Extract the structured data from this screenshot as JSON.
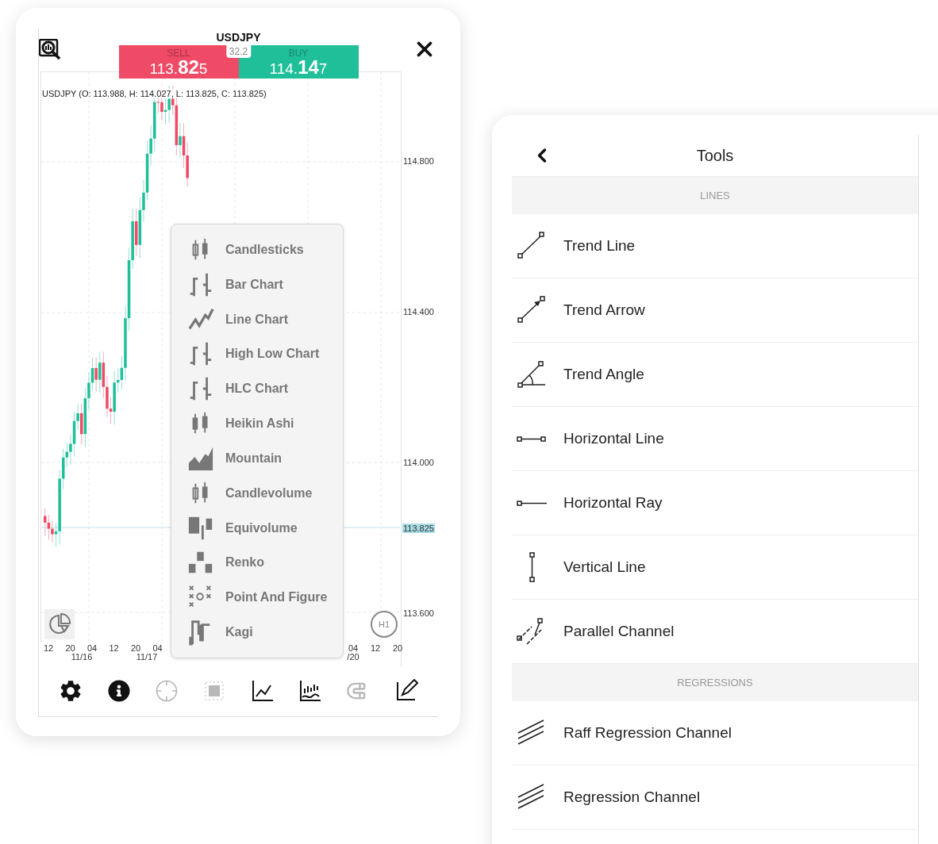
{
  "chart_window": {
    "title": "USDJPY",
    "quote": {
      "sell": {
        "label": "SELL",
        "price_head": "113.",
        "price_big": "82",
        "price_tail": "5"
      },
      "spread": "32.2",
      "buy": {
        "label": "BUY",
        "price_head": "114.",
        "price_big": "14",
        "price_tail": "7"
      }
    },
    "ohlc": "USDJPY (O: 113.988, H: 114.027, L: 113.825, C: 113.825)",
    "price_axis": [
      {
        "label": "114.800",
        "kind": "tick"
      },
      {
        "label": "114.400",
        "kind": "tick"
      },
      {
        "label": "114.000",
        "kind": "tick"
      },
      {
        "label": "113.825",
        "kind": "current"
      },
      {
        "label": "113.600",
        "kind": "tick"
      }
    ],
    "time_axis": {
      "left_hours": [
        "12",
        "20",
        "04",
        "12",
        "20",
        "04"
      ],
      "left_dates": [
        "11/16",
        "11/17"
      ],
      "right_hours": [
        "04",
        "12",
        "20"
      ],
      "right_dates": [
        "/20"
      ]
    },
    "timeframe": "H1",
    "chart_type_menu": [
      {
        "label": "Candlesticks"
      },
      {
        "label": "Bar Chart"
      },
      {
        "label": "Line Chart"
      },
      {
        "label": "High Low Chart"
      },
      {
        "label": "HLC Chart"
      },
      {
        "label": "Heikin Ashi"
      },
      {
        "label": "Mountain"
      },
      {
        "label": "Candlevolume"
      },
      {
        "label": "Equivolume"
      },
      {
        "label": "Renko"
      },
      {
        "label": "Point And Figure"
      },
      {
        "label": "Kagi"
      }
    ],
    "toolbar": [
      {
        "disabled": false
      },
      {
        "disabled": false
      },
      {
        "disabled": true
      },
      {
        "disabled": true
      },
      {
        "disabled": false
      },
      {
        "disabled": false
      },
      {
        "disabled": true
      },
      {
        "disabled": false
      }
    ]
  },
  "tools_panel": {
    "title": "Tools",
    "sections": [
      {
        "header": "LINES",
        "items": [
          {
            "label": "Trend Line"
          },
          {
            "label": "Trend Arrow"
          },
          {
            "label": "Trend Angle"
          },
          {
            "label": "Horizontal Line"
          },
          {
            "label": "Horizontal Ray"
          },
          {
            "label": "Vertical Line"
          },
          {
            "label": "Parallel Channel"
          }
        ]
      },
      {
        "header": "REGRESSIONS",
        "items": [
          {
            "label": "Raff Regression Channel"
          },
          {
            "label": "Regression Channel"
          }
        ]
      }
    ]
  }
}
